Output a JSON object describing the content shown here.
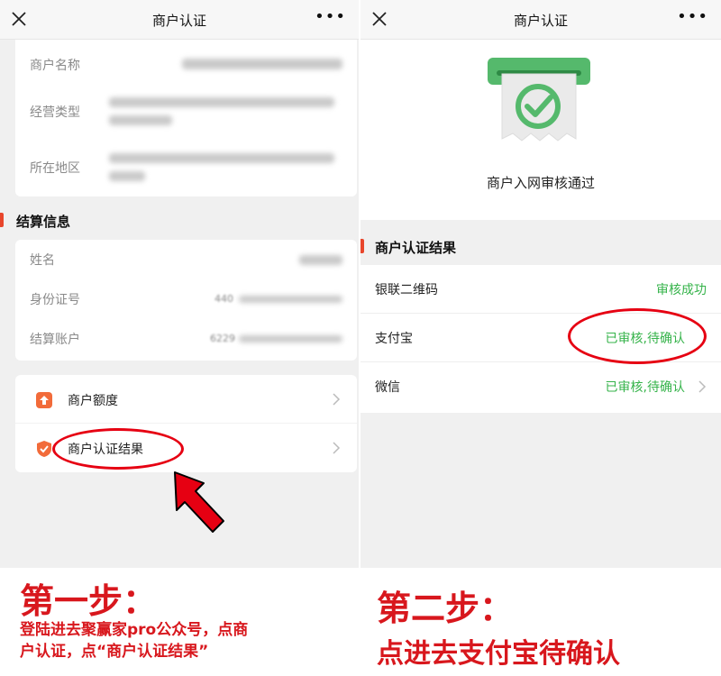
{
  "left_screen": {
    "nav": {
      "title": "商户认证",
      "close_icon": "close-icon",
      "more_label": "•••"
    },
    "merchant_info": {
      "fields": [
        {
          "label": "商户名称"
        },
        {
          "label": "经营类型"
        },
        {
          "label": "所在地区"
        }
      ]
    },
    "settlement": {
      "title": "结算信息",
      "fields": [
        {
          "label": "姓名"
        },
        {
          "label": "身份证号",
          "value_visible": "440"
        },
        {
          "label": "结算账户",
          "value_visible": "6229"
        }
      ]
    },
    "menu": [
      {
        "label": "商户额度",
        "icon": "quota-upload-icon"
      },
      {
        "label": "商户认证结果",
        "icon": "shield-icon"
      }
    ]
  },
  "right_screen": {
    "nav": {
      "title": "商户认证",
      "close_icon": "close-icon",
      "more_label": "•••"
    },
    "hero": {
      "icon": "approved-receipt-icon",
      "text": "商户入网审核通过"
    },
    "result_section": {
      "title": "商户认证结果",
      "rows": [
        {
          "label": "银联二维码",
          "status": "审核成功",
          "has_chevron": false
        },
        {
          "label": "支付宝",
          "status": "已审核,待确认",
          "has_chevron": false
        },
        {
          "label": "微信",
          "status": "已审核,待确认",
          "has_chevron": true
        }
      ]
    }
  },
  "annotations": {
    "step1": {
      "title": "第一步：",
      "desc_line1": "登陆进去聚赢家pro公众号，点商",
      "desc_line2": "户认证，点“商户认证结果”"
    },
    "step2": {
      "title": "第二步：",
      "desc": "点进去支付宝待确认"
    }
  },
  "colors": {
    "accent_red": "#e8462c",
    "annotation_red": "#d8171d",
    "success_green": "#35b34a",
    "ellipse_red": "#e60012"
  }
}
